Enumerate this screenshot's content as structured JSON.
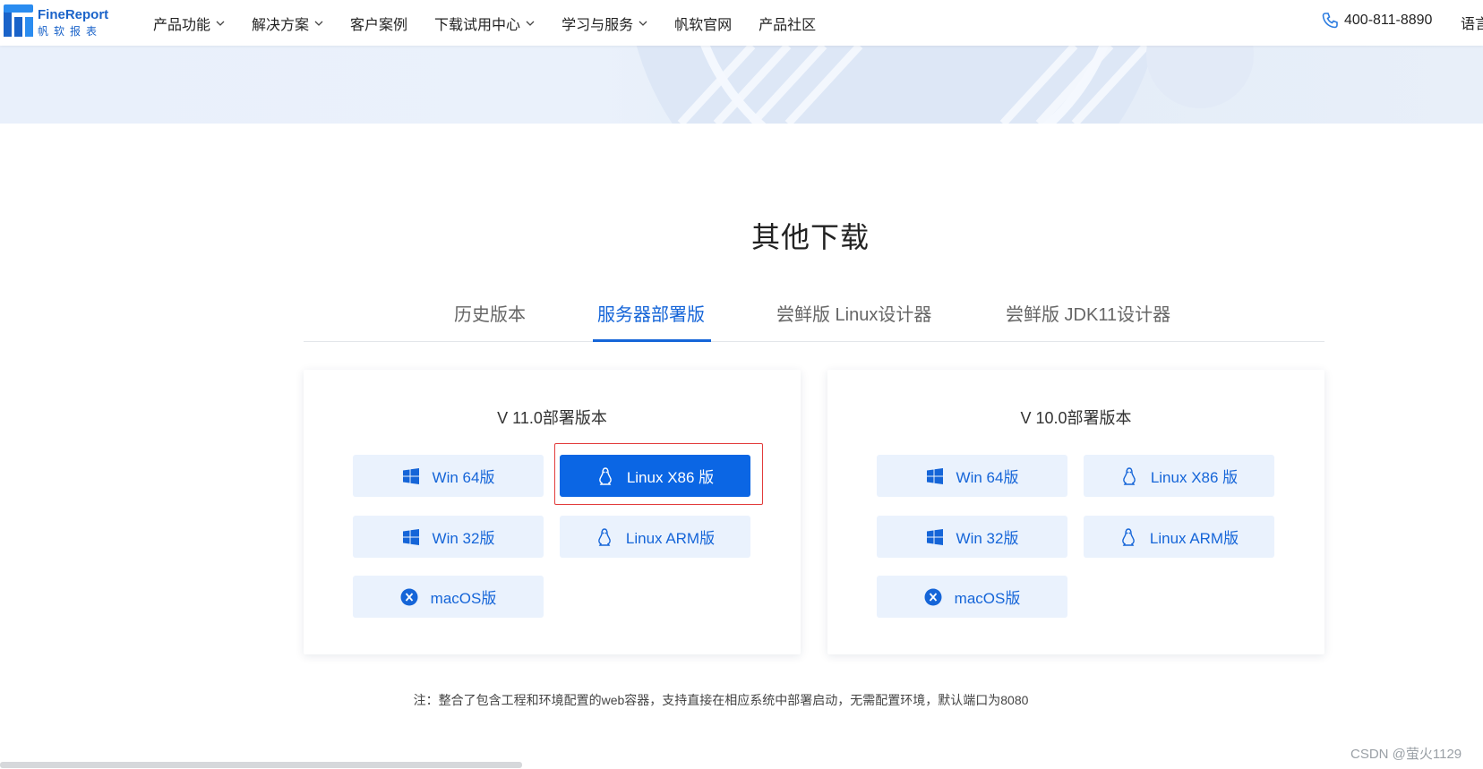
{
  "header": {
    "logo_name": "FineReport",
    "logo_sub": "帆软报表",
    "nav": [
      {
        "label": "产品功能",
        "dropdown": true
      },
      {
        "label": "解决方案",
        "dropdown": true
      },
      {
        "label": "客户案例",
        "dropdown": false
      },
      {
        "label": "下载试用中心",
        "dropdown": true
      },
      {
        "label": "学习与服务",
        "dropdown": true
      },
      {
        "label": "帆软官网",
        "dropdown": false
      },
      {
        "label": "产品社区",
        "dropdown": false
      }
    ],
    "phone": "400-811-8890",
    "language": "语言"
  },
  "section_title": "其他下载",
  "tabs": [
    {
      "label": "历史版本",
      "active": false
    },
    {
      "label": "服务器部署版",
      "active": true
    },
    {
      "label": "尝鲜版 Linux设计器",
      "active": false
    },
    {
      "label": "尝鲜版 JDK11设计器",
      "active": false
    }
  ],
  "cards": [
    {
      "title": "V 11.0部署版本",
      "buttons": [
        {
          "label": "Win 64版",
          "icon": "windows-icon",
          "primary": false
        },
        {
          "label": "Linux X86 版",
          "icon": "linux-icon",
          "primary": true
        },
        {
          "label": "Win 32版",
          "icon": "windows-icon",
          "primary": false
        },
        {
          "label": "Linux ARM版",
          "icon": "linux-icon",
          "primary": false
        },
        {
          "label": "macOS版",
          "icon": "macos-icon",
          "primary": false
        }
      ]
    },
    {
      "title": "V 10.0部署版本",
      "buttons": [
        {
          "label": "Win 64版",
          "icon": "windows-icon",
          "primary": false
        },
        {
          "label": "Linux X86 版",
          "icon": "linux-icon",
          "primary": false
        },
        {
          "label": "Win 32版",
          "icon": "windows-icon",
          "primary": false
        },
        {
          "label": "Linux ARM版",
          "icon": "linux-icon",
          "primary": false
        },
        {
          "label": "macOS版",
          "icon": "macos-icon",
          "primary": false
        }
      ]
    }
  ],
  "note": "注：整合了包含工程和环境配置的web容器，支持直接在相应系统中部署启动，无需配置环境，默认端口为8080",
  "watermark": "CSDN @萤火1129",
  "colors": {
    "accent": "#1565d8",
    "button_bg": "#eaf2fd",
    "primary_bg": "#0b66e4",
    "highlight": "#e23b3b"
  }
}
